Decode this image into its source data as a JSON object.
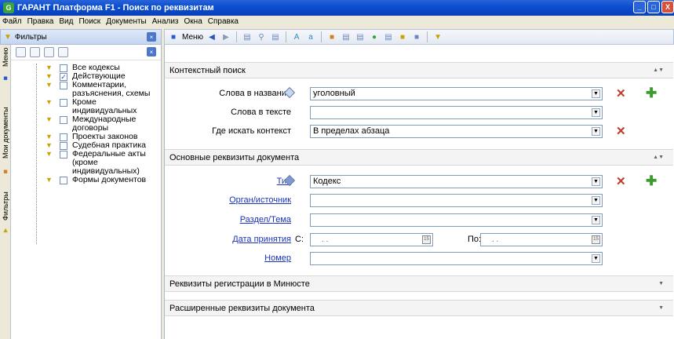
{
  "window": {
    "title": "ГАРАНТ Платформа F1 - Поиск по реквизитам",
    "icon_letter": "G"
  },
  "menu": [
    "Файл",
    "Правка",
    "Вид",
    "Поиск",
    "Документы",
    "Анализ",
    "Окна",
    "Справка"
  ],
  "left_panel": {
    "header": "Фильтры",
    "vertical_tabs": [
      "Меню",
      "Мои документы",
      "Фильтры"
    ],
    "tree": [
      {
        "label": "Все кодексы",
        "checked": false
      },
      {
        "label": "Действующие",
        "checked": true
      },
      {
        "label": "Комментарии, разъяснения, схемы",
        "checked": false
      },
      {
        "label": "Кроме индивидуальных",
        "checked": false
      },
      {
        "label": "Международные договоры",
        "checked": false
      },
      {
        "label": "Проекты законов",
        "checked": false
      },
      {
        "label": "Судебная практика",
        "checked": false
      },
      {
        "label": "Федеральные акты (кроме индивидуальных)",
        "checked": false
      },
      {
        "label": "Формы документов",
        "checked": false
      }
    ]
  },
  "toolbar": {
    "menu_label": "Меню"
  },
  "sections": {
    "context": {
      "title": "Контекстный поиск",
      "rows": [
        {
          "label": "Слова в названии",
          "value": ""
        },
        {
          "label": "Слова в тексте",
          "value": ""
        },
        {
          "label": "Где искать контекст",
          "value": "В пределах абзаца"
        }
      ],
      "name_value": "уголовный"
    },
    "main": {
      "title": "Основные реквизиты документа",
      "rows": [
        {
          "label": "Тип",
          "value": "Кодекс"
        },
        {
          "label": "Орган/источник",
          "value": ""
        },
        {
          "label": "Раздел/Тема",
          "value": ""
        },
        {
          "label": "Дата принятия",
          "value": ""
        },
        {
          "label": "Номер",
          "value": ""
        }
      ],
      "date_from_label": "С:",
      "date_to_label": "По:",
      "date_placeholder": ". ."
    },
    "minjust": {
      "title": "Реквизиты регистрации в Минюсте"
    },
    "extended": {
      "title": "Расширенные реквизиты документа"
    }
  }
}
